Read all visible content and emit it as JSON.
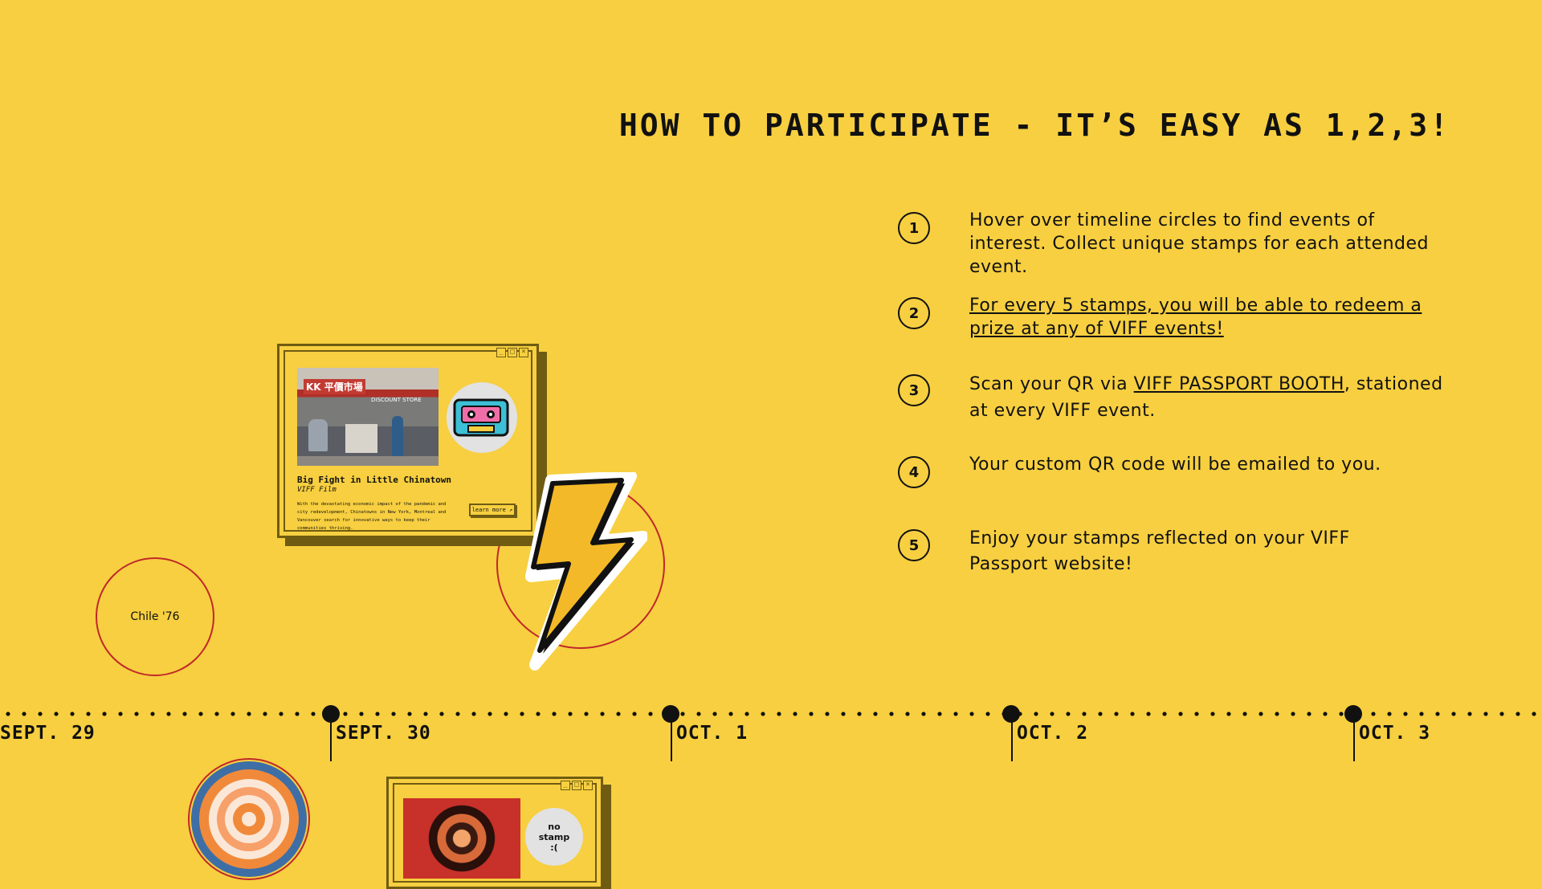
{
  "heading": "HOW TO PARTICIPATE - IT’S EASY AS 1,2,3!",
  "steps": [
    {
      "number": "1",
      "text": "Hover over timeline circles to find events of interest. Collect unique stamps for each attended event."
    },
    {
      "number": "2",
      "text": "For every 5 stamps, you will be able to redeem a prize at any of VIFF events!"
    },
    {
      "number": "3",
      "text_before": "Scan your QR via ",
      "link": "VIFF PASSPORT BOOTH",
      "text_after": ", stationed at every VIFF event."
    },
    {
      "number": "4",
      "text": "Your custom QR code will be emailed to you."
    },
    {
      "number": "5",
      "text": "Enjoy your stamps reflected on your VIFF Passport website!"
    }
  ],
  "events": {
    "chile": {
      "label": "Chile '76"
    },
    "card": {
      "title": "Big Fight in Little Chinatown",
      "subtitle": "VIFF Film",
      "description": "With the devastating economic impact of the pandemic and city redevelopment, Chinatowns in New York, Montreal and Vancouver search for innovative ways to keep their communities thriving.",
      "learn_more": "learn more ↗",
      "photo_sign": "KK 平價市場",
      "photo_sign_sub": "DISCOUNT STORE"
    },
    "card2": {
      "stamp_text": "no stamp :("
    }
  },
  "window_controls": [
    "_",
    "□",
    "×"
  ],
  "timeline": {
    "days": [
      "SEPT. 29",
      "SEPT. 30",
      "OCT. 1",
      "OCT. 2",
      "OCT. 3"
    ]
  },
  "icons": [
    "cassette-icon",
    "lightning-bolt-icon",
    "flower-stamp-icon",
    "kaleidoscope-image"
  ],
  "colors": {
    "background": "#f7cf40",
    "circle_border": "#c0282a",
    "card_border": "#6f5b12",
    "text": "#111111"
  }
}
